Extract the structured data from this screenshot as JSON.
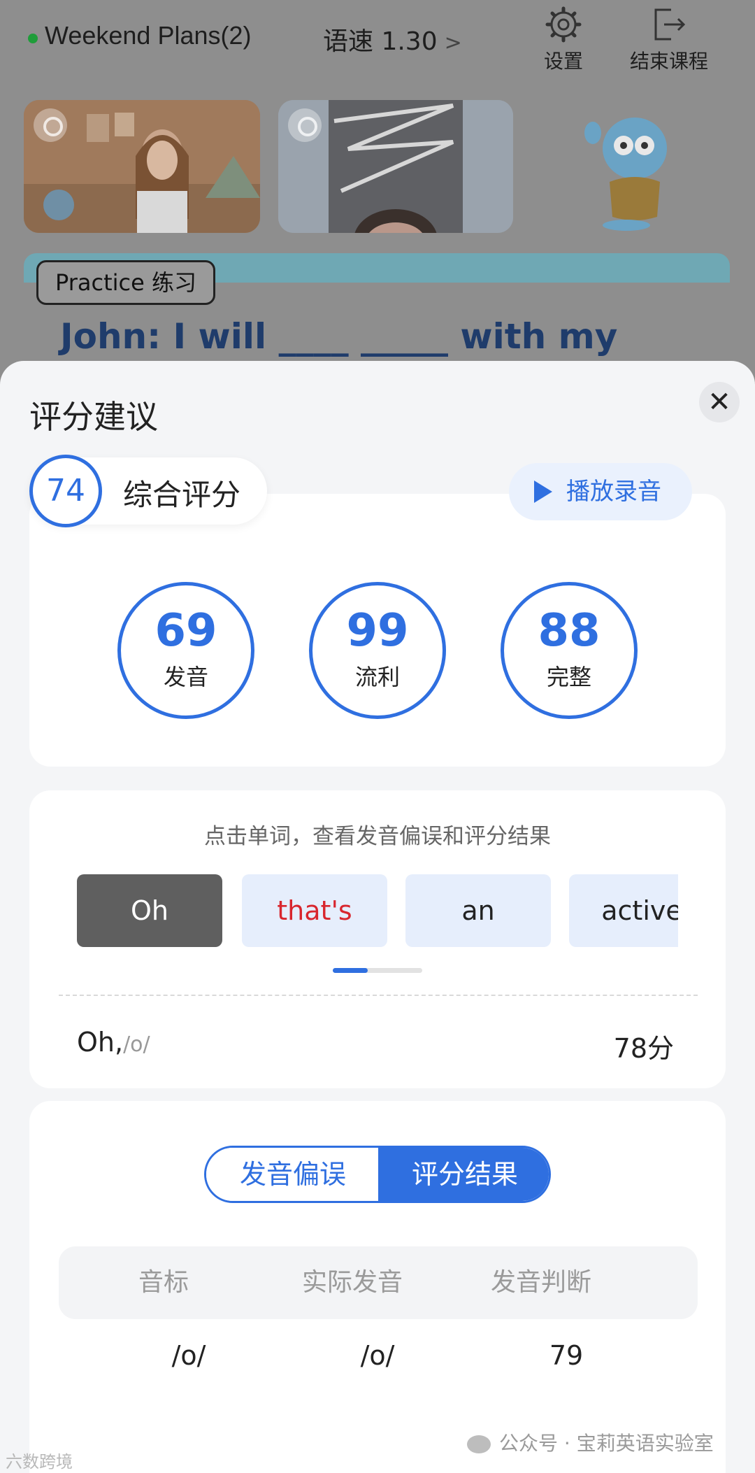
{
  "topbar": {
    "lesson_title": "Weekend Plans(2)",
    "speed_label": "语速 1.30",
    "speed_chevron": ">",
    "settings_label": "设置",
    "settings_icon": "gear-icon",
    "exit_label": "结束课程",
    "exit_icon": "exit-icon",
    "status_color": "#1f9d3a"
  },
  "practice": {
    "tag": "Practice 练习",
    "sentence": "John: I will ____ _____ with my friends."
  },
  "sheet": {
    "title": "评分建议",
    "close_label": "✕",
    "overall": {
      "score": "74",
      "label": "综合评分"
    },
    "play_label": "播放录音",
    "scores": [
      {
        "value": "69",
        "label": "发音"
      },
      {
        "value": "99",
        "label": "流利"
      },
      {
        "value": "88",
        "label": "完整"
      }
    ],
    "hint": "点击单词，查看发音偏误和评分结果",
    "words": [
      {
        "text": "Oh",
        "state": "selected"
      },
      {
        "text": "that's",
        "state": "error"
      },
      {
        "text": "an",
        "state": "normal"
      },
      {
        "text": "active",
        "state": "normal"
      }
    ],
    "selected_word": {
      "word": "Oh,",
      "ipa": "/o/",
      "score": "78分"
    },
    "tabs": {
      "left": "发音偏误",
      "right": "评分结果",
      "active": "right"
    },
    "table": {
      "headers": [
        "音标",
        "实际发音",
        "发音判断"
      ],
      "rows": [
        [
          "/o/",
          "/o/",
          "79"
        ]
      ]
    }
  },
  "watermarks": {
    "left": "六数跨境",
    "right": "公众号 · 宝莉英语实验室"
  },
  "colors": {
    "accent": "#2f6fe0",
    "error": "#d8262e",
    "selected_chip": "#5f5f5f"
  }
}
